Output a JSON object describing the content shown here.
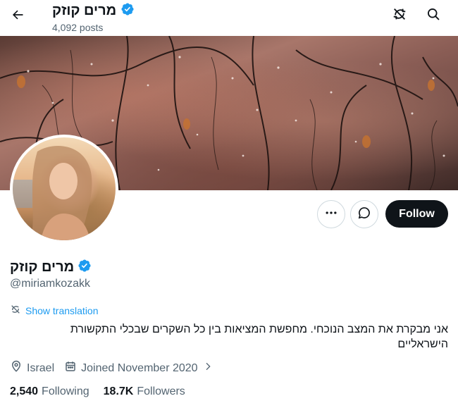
{
  "header": {
    "name": "מרים קוזק",
    "posts_count": "4,092 posts",
    "icons": {
      "back": "arrow-left-icon",
      "translate": "translate-icon",
      "search": "search-icon"
    }
  },
  "profile": {
    "name": "מרים קוזק",
    "handle": "@miriamkozakk",
    "verified": true,
    "verified_color": "#1d9bf0",
    "show_translation_label": "Show translation",
    "bio_line1": "אני מבקרת את המצב הנוכחי. מחפשת המציאות בין כל השקרים שבכלי התקשורת",
    "bio_line2": "הישראליים",
    "location": "Israel",
    "joined": "Joined November 2020",
    "following_count": "2,540",
    "following_label": "Following",
    "followers_count": "18.7K",
    "followers_label": "Followers"
  },
  "actions": {
    "follow_label": "Follow"
  },
  "colors": {
    "accent": "#1d9bf0",
    "text_primary": "#0f1419",
    "text_secondary": "#536471",
    "border": "#cfd9de"
  }
}
